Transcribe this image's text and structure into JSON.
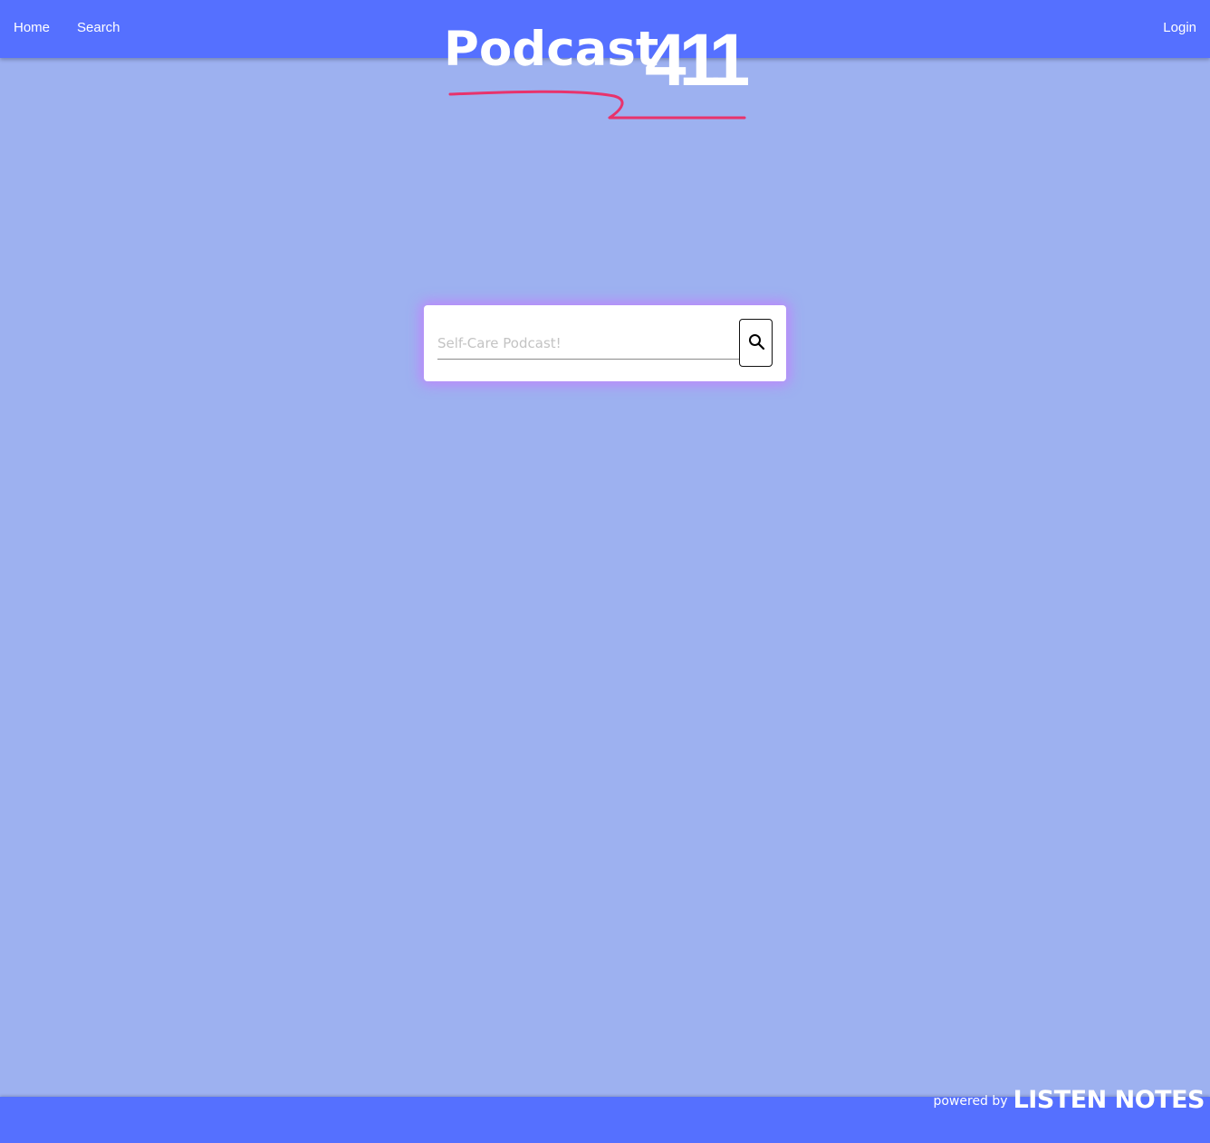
{
  "nav": {
    "home": "Home",
    "search": "Search",
    "login": "Login"
  },
  "logo": {
    "text": "Podcast",
    "number": "411",
    "underline_color": "#e8336c"
  },
  "search": {
    "placeholder": "Self-Care Podcast!",
    "value": "",
    "button_icon": "search-icon"
  },
  "footer": {
    "powered_by": "powered by",
    "brand": "LISTEN NOTES"
  },
  "colors": {
    "navbar": "#5570ff",
    "background": "#9db1f0",
    "card_glow": "#c878ff"
  }
}
